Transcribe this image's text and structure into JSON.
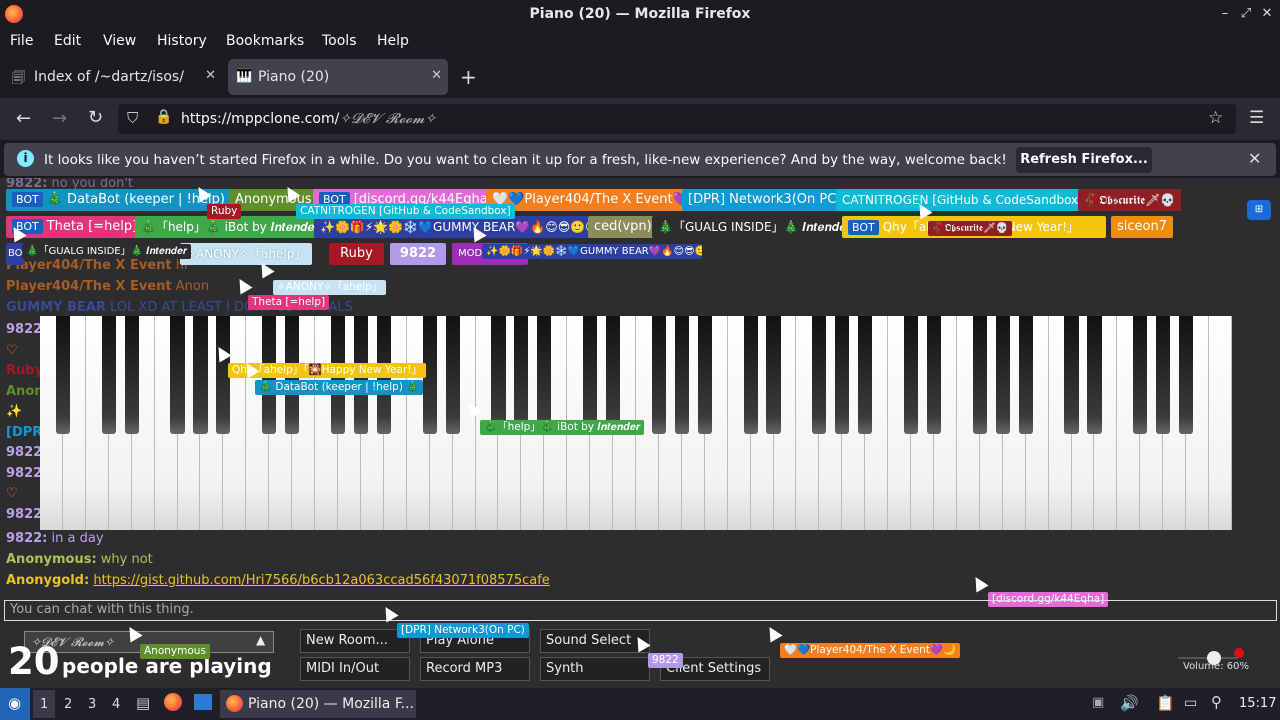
{
  "window": {
    "title": "Piano (20) — Mozilla Firefox"
  },
  "menu": [
    "File",
    "Edit",
    "View",
    "History",
    "Bookmarks",
    "Tools",
    "Help"
  ],
  "tabs": [
    {
      "label": "Index of /~dartz/isos/"
    },
    {
      "label": "Piano (20)"
    }
  ],
  "nav": {
    "url_host": "https://mppclone.com/",
    "url_path": "✧𝓓𝓔𝓥 𝓡𝓸𝓸𝓶✧"
  },
  "infobar": {
    "message": "It looks like you haven’t started Firefox in a while. Do you want to clean it up for a fresh, like-new experience? And by the way, welcome back!",
    "button": "Refresh Firefox..."
  },
  "chat_top": [
    {
      "name": "9822:",
      "text": "no you don't"
    },
    {
      "name": "Player404/The X Event",
      "text": "hi"
    },
    {
      "name": "Player404/The X Event",
      "text": "Anon"
    },
    {
      "name": "GUMMY BEAR",
      "text": "LOL XD AT LEAST I DONT US MY PALS"
    }
  ],
  "left_names": [
    "9822",
    "",
    "Ruby",
    "Anon",
    "",
    "[DPR",
    "9822",
    "9822",
    "",
    "9822"
  ],
  "chat_bottom": [
    {
      "name": "9822:",
      "text": "in a day",
      "color": "#b9a3e6"
    },
    {
      "name": "Anonymous:",
      "text": "why not",
      "color": "#a9c45a"
    },
    {
      "name": "Anonygold:",
      "text": "https://gist.github.com/Hri7566/b6cb12a063ccad56f43071f08575cafe",
      "color": "#e8c324"
    }
  ],
  "users": [
    {
      "bot": "BOT",
      "label": "🎄 DataBot (keeper | !help) 🎄",
      "bg": "#1392c4",
      "color": "#fff"
    },
    {
      "label": "Anonymous",
      "bg": "#5f8f2c",
      "color": "#fff"
    },
    {
      "bot": "BOT",
      "label": "[discord.gg/k44Eqha]",
      "bg": "#e46ad8",
      "color": "#fff"
    },
    {
      "label": "🤍💙Player404/The X Event💜🌙",
      "bg": "#f57e20",
      "color": "#fff"
    },
    {
      "label": "[DPR] Network3(On PC)",
      "bg": "#0e9ad5",
      "color": "#fff"
    },
    {
      "label": "CATNITROGEN [GitHub & CodeSandbox]",
      "bg": "#0dbbd7",
      "color": "#fff"
    },
    {
      "label": "🥀𝕺𝖇𝖘𝖈𝖚𝖗𝖎𝖙𝖊🗡💀",
      "bg": "#8f1f24",
      "color": "#fff"
    },
    {
      "bot": "BOT",
      "label": "Theta [=help]",
      "bg": "#e1377a",
      "color": "#fff"
    },
    {
      "label": "🎄「help」🎄 iBot by 𝑰𝒏𝒕𝒆𝒏𝒅𝒆𝒓",
      "bg": "#3fa84b",
      "color": "#fff"
    },
    {
      "label": "✨🌼🎁⚡🌟🌼❄️💙GUMMY BEAR💜🔥😊😎🙂😊",
      "bg": "#2d3fa0",
      "color": "#fff"
    },
    {
      "label": "ced(vpn)",
      "bg": "#8b8d5a",
      "color": "#fff"
    },
    {
      "label": "🎄「GUALG INSIDE」🎄 𝑰𝒏𝒕𝒆𝒏𝒅𝒆𝒓",
      "bg": "#2d2d2f",
      "color": "#fff"
    },
    {
      "bot": "BOT",
      "label": "Qhy「ahelp」Happy New Year!」",
      "bg": "#f3c60d",
      "color": "#fff"
    },
    {
      "label": "siceon7",
      "bg": "#f28c0d",
      "color": "#fff"
    },
    {
      "label": "✧ANONY✧「ahelp」",
      "bg": "#c7e3f3",
      "color": "#fff"
    },
    {
      "label": "Ruby",
      "bg": "#a41923",
      "color": "#fff"
    },
    {
      "label": "9822",
      "bg": "#b39ae8",
      "color": "#fff"
    },
    {
      "label": "MOD",
      "bg": "#9b2db8",
      "color": "#fff"
    }
  ],
  "cursor_tags": [
    {
      "label": "Ruby",
      "bg": "#a41923"
    },
    {
      "label": "CATNITROGEN [GitHub & CodeSandbox]",
      "bg": "#0dbbd7"
    },
    {
      "label": "✨🌼🎁⚡🌟🌼❄️💙GUMMY BEAR💜🔥😊😎🙂😊",
      "bg": "#2d3fa0"
    },
    {
      "label": "🎄「GUALG INSIDE」🎄 𝑰𝒏𝒕𝒆𝒏𝒅𝒆𝒓",
      "bg": "#2d2d2f"
    },
    {
      "label": "🥀𝕺𝖇𝖘𝖈𝖚𝖗𝖎𝖙𝖊🗡💀",
      "bg": "#8f1f24"
    },
    {
      "label": "✧ANONY✧「ahelp」",
      "bg": "#c7e3f3"
    },
    {
      "label": "Theta [=help]",
      "bg": "#e1377a"
    },
    {
      "label": "Qhy「ahelp」「🎇Happy New Year!」",
      "bg": "#f3c60d"
    },
    {
      "label": "🎄 DataBot (keeper | !help) 🎄",
      "bg": "#1392c4"
    },
    {
      "label": "🎄「help」🎄 iBot by 𝑰𝒏𝒕𝒆𝒏𝒅𝒆𝒓",
      "bg": "#3fa84b"
    },
    {
      "label": "[discord.gg/k44Eqha]",
      "bg": "#e46ad8"
    },
    {
      "label": "[DPR] Network3(On PC)",
      "bg": "#0e9ad5"
    },
    {
      "label": "Anonymous",
      "bg": "#5f8f2c"
    },
    {
      "label": "9822",
      "bg": "#b39ae8"
    },
    {
      "label": "🤍💙Player404/The X Event💜🌙",
      "bg": "#f57e20"
    }
  ],
  "chat_input_placeholder": "You can chat with this thing.",
  "room": {
    "name": "✧𝓓𝓔𝓥 𝓡𝓸𝓸𝓶✧"
  },
  "players": {
    "count": "20",
    "label": "people are playing"
  },
  "controls": [
    "New Room...",
    "Play Alone",
    "Sound Select",
    "MIDI In/Out",
    "Record MP3",
    "Synth",
    "Client Settings"
  ],
  "volume": {
    "label": "Volume: 60%",
    "value": 0.6
  },
  "taskbar": {
    "workspaces": [
      "1",
      "2",
      "3",
      "4"
    ],
    "window": "Piano (20) — Mozilla F...",
    "clock": "15:17"
  },
  "colors": {
    "accent": "#0061e0",
    "bg": "#1c1b22"
  }
}
